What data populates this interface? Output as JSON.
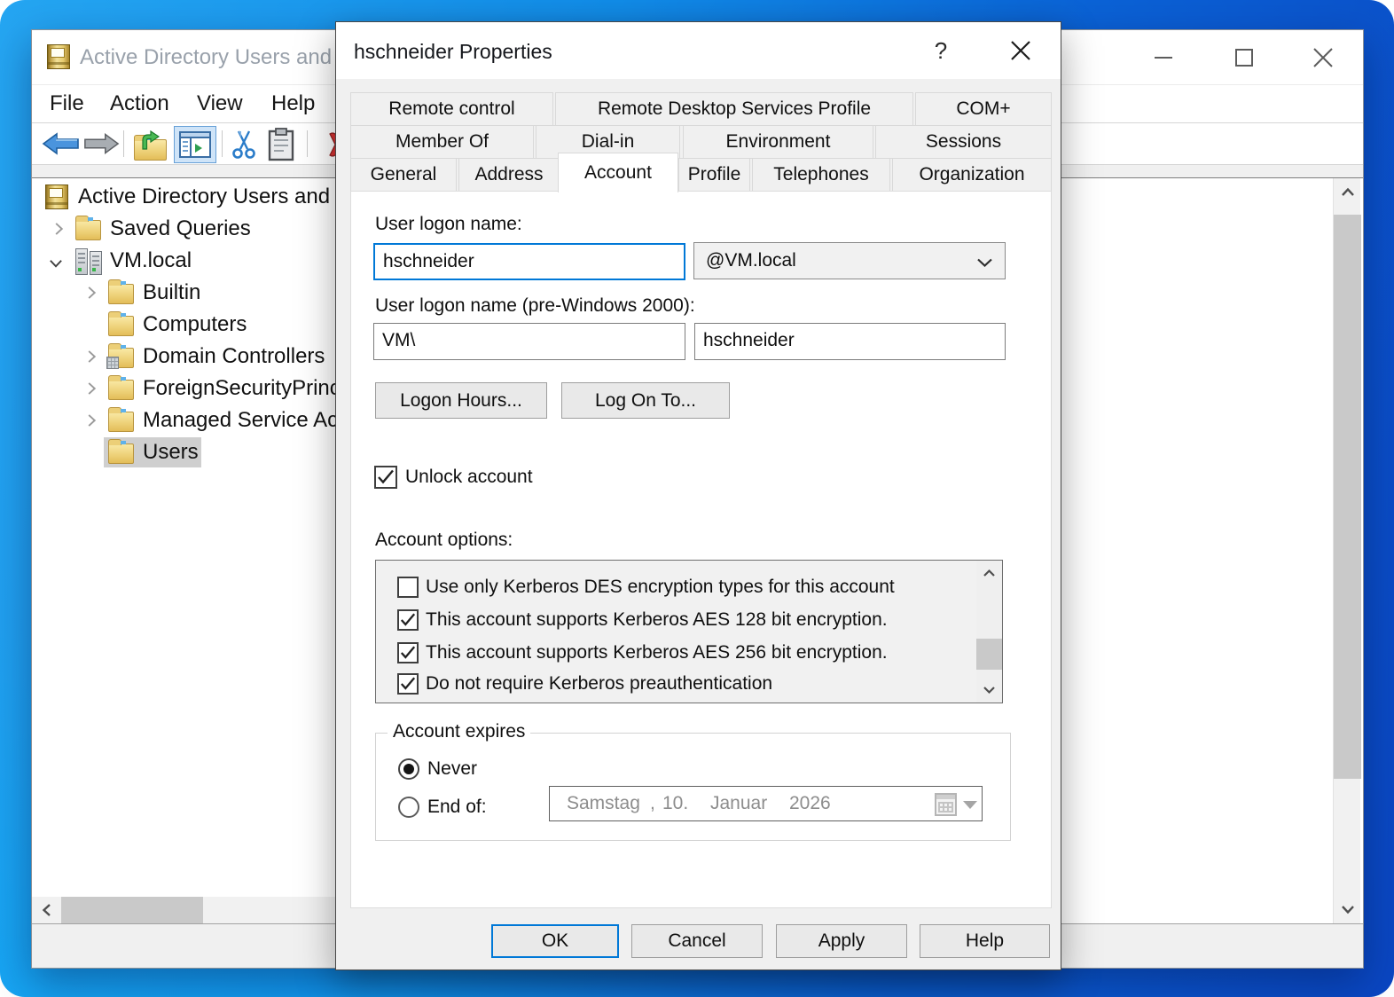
{
  "colors": {
    "accent": "#0078d7",
    "desktop_gradient_from": "#25a6f2",
    "desktop_gradient_to": "#0a46c2",
    "dialog_bg": "#f0f0f0",
    "selection_gray": "#cfcfcf"
  },
  "main_window": {
    "title": "Active Directory Users and Computers",
    "menu": {
      "file": "File",
      "action": "Action",
      "view": "View",
      "help": "Help"
    },
    "tree": {
      "root_label": "Active Directory Users and Computers",
      "items": [
        {
          "label": "Saved Queries"
        },
        {
          "label": "VM.local"
        },
        {
          "label": "Builtin"
        },
        {
          "label": "Computers"
        },
        {
          "label": "Domain Controllers"
        },
        {
          "label": "ForeignSecurityPrincipals"
        },
        {
          "label": "Managed Service Accounts"
        },
        {
          "label": "Users"
        }
      ],
      "selected_item": "Users"
    }
  },
  "dialog": {
    "title": "hschneider Properties",
    "help_glyph": "?",
    "tabs": {
      "row1": [
        "Remote control",
        "Remote Desktop Services Profile",
        "COM+"
      ],
      "row2": [
        "Member Of",
        "Dial-in",
        "Environment",
        "Sessions"
      ],
      "row3": [
        "General",
        "Address",
        "Account",
        "Profile",
        "Telephones",
        "Organization"
      ],
      "active": "Account"
    },
    "account": {
      "logon_name_label": "User logon name:",
      "logon_name_value": "hschneider",
      "domain_suffix_value": "@VM.local",
      "pre2000_label": "User logon name (pre-Windows 2000):",
      "pre2000_domain_value": "VM\\",
      "pre2000_name_value": "hschneider",
      "logon_hours_button": "Logon Hours...",
      "log_on_to_button": "Log On To...",
      "unlock_label": "Unlock account",
      "options_label": "Account options:",
      "options": [
        {
          "checked": false,
          "label": "Use only Kerberos DES encryption types for this account"
        },
        {
          "checked": true,
          "label": "This account supports Kerberos AES 128 bit encryption."
        },
        {
          "checked": true,
          "label": "This account supports Kerberos AES 256 bit encryption."
        },
        {
          "checked": true,
          "label": "Do not require Kerberos preauthentication"
        }
      ],
      "expires_label": "Account expires",
      "never_label": "Never",
      "end_of_label": "End of:",
      "date_value": {
        "day": "Samstag",
        "comma": ",",
        "daynum": "10.",
        "month": "Januar",
        "year": "2026"
      },
      "expires_selected": "Never"
    },
    "buttons": {
      "ok": "OK",
      "cancel": "Cancel",
      "apply": "Apply",
      "help": "Help"
    }
  }
}
